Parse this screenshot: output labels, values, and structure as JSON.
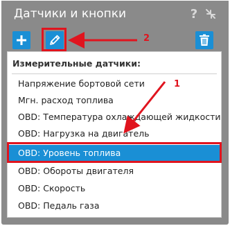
{
  "window": {
    "title": "Датчики и кнопки",
    "help_glyph": "?"
  },
  "toolbar": {
    "add_icon": "plus-icon",
    "edit_icon": "pencil-icon",
    "delete_icon": "trash-icon"
  },
  "list": {
    "header": "Измерительные датчики:",
    "items": [
      "Напряжение бортовой сети",
      "Мгн. расход топлива",
      "OBD: Температура охлаждающей жидкости",
      "OBD: Нагрузка на двигатель",
      "OBD: Уровень топлива",
      "OBD: Обороты двигателя",
      "OBD: Скорость",
      "OBD: Педаль газа"
    ],
    "selected_index": 4
  },
  "annotations": {
    "label_1": "1",
    "label_2": "2"
  },
  "colors": {
    "accent": "#1a8fd5",
    "annotation": "#e0141e",
    "titlebar": "#8a8a8a"
  }
}
